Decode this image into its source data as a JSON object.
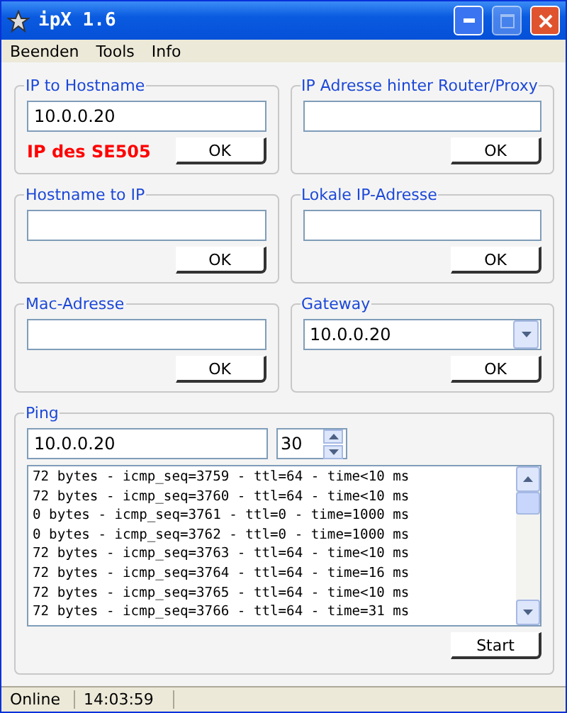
{
  "window": {
    "title": "ipX 1.6"
  },
  "menu": [
    "Beenden",
    "Tools",
    "Info"
  ],
  "groups": [
    {
      "kind": "text",
      "title": "IP to Hostname",
      "value": "10.0.0.20",
      "note": "IP des SE505",
      "button": "OK"
    },
    {
      "kind": "text",
      "title": "IP Adresse hinter Router/Proxy",
      "button": "OK"
    },
    {
      "kind": "text",
      "title": "Hostname to IP",
      "button": "OK"
    },
    {
      "kind": "text",
      "title": "Lokale IP-Adresse",
      "button": "OK"
    },
    {
      "kind": "text",
      "title": "Mac-Adresse",
      "button": "OK"
    },
    {
      "kind": "combo",
      "title": "Gateway",
      "value": "10.0.0.20",
      "button": "OK"
    }
  ],
  "ping": {
    "title": "Ping",
    "host": "10.0.0.20",
    "count": "30",
    "button": "Start",
    "log": [
      "72 bytes - icmp_seq=3759 - ttl=64 - time<10 ms",
      "72 bytes - icmp_seq=3760 - ttl=64 - time<10 ms",
      "0 bytes - icmp_seq=3761 - ttl=0 - time=1000 ms",
      "0 bytes - icmp_seq=3762 - ttl=0 - time=1000 ms",
      "72 bytes - icmp_seq=3763 - ttl=64 - time<10 ms",
      "72 bytes - icmp_seq=3764 - ttl=64 - time=16 ms",
      "72 bytes - icmp_seq=3765 - ttl=64 - time<10 ms",
      "72 bytes - icmp_seq=3766 - ttl=64 - time=31 ms"
    ]
  },
  "status_bar": [
    "Online",
    "14:03:59"
  ]
}
